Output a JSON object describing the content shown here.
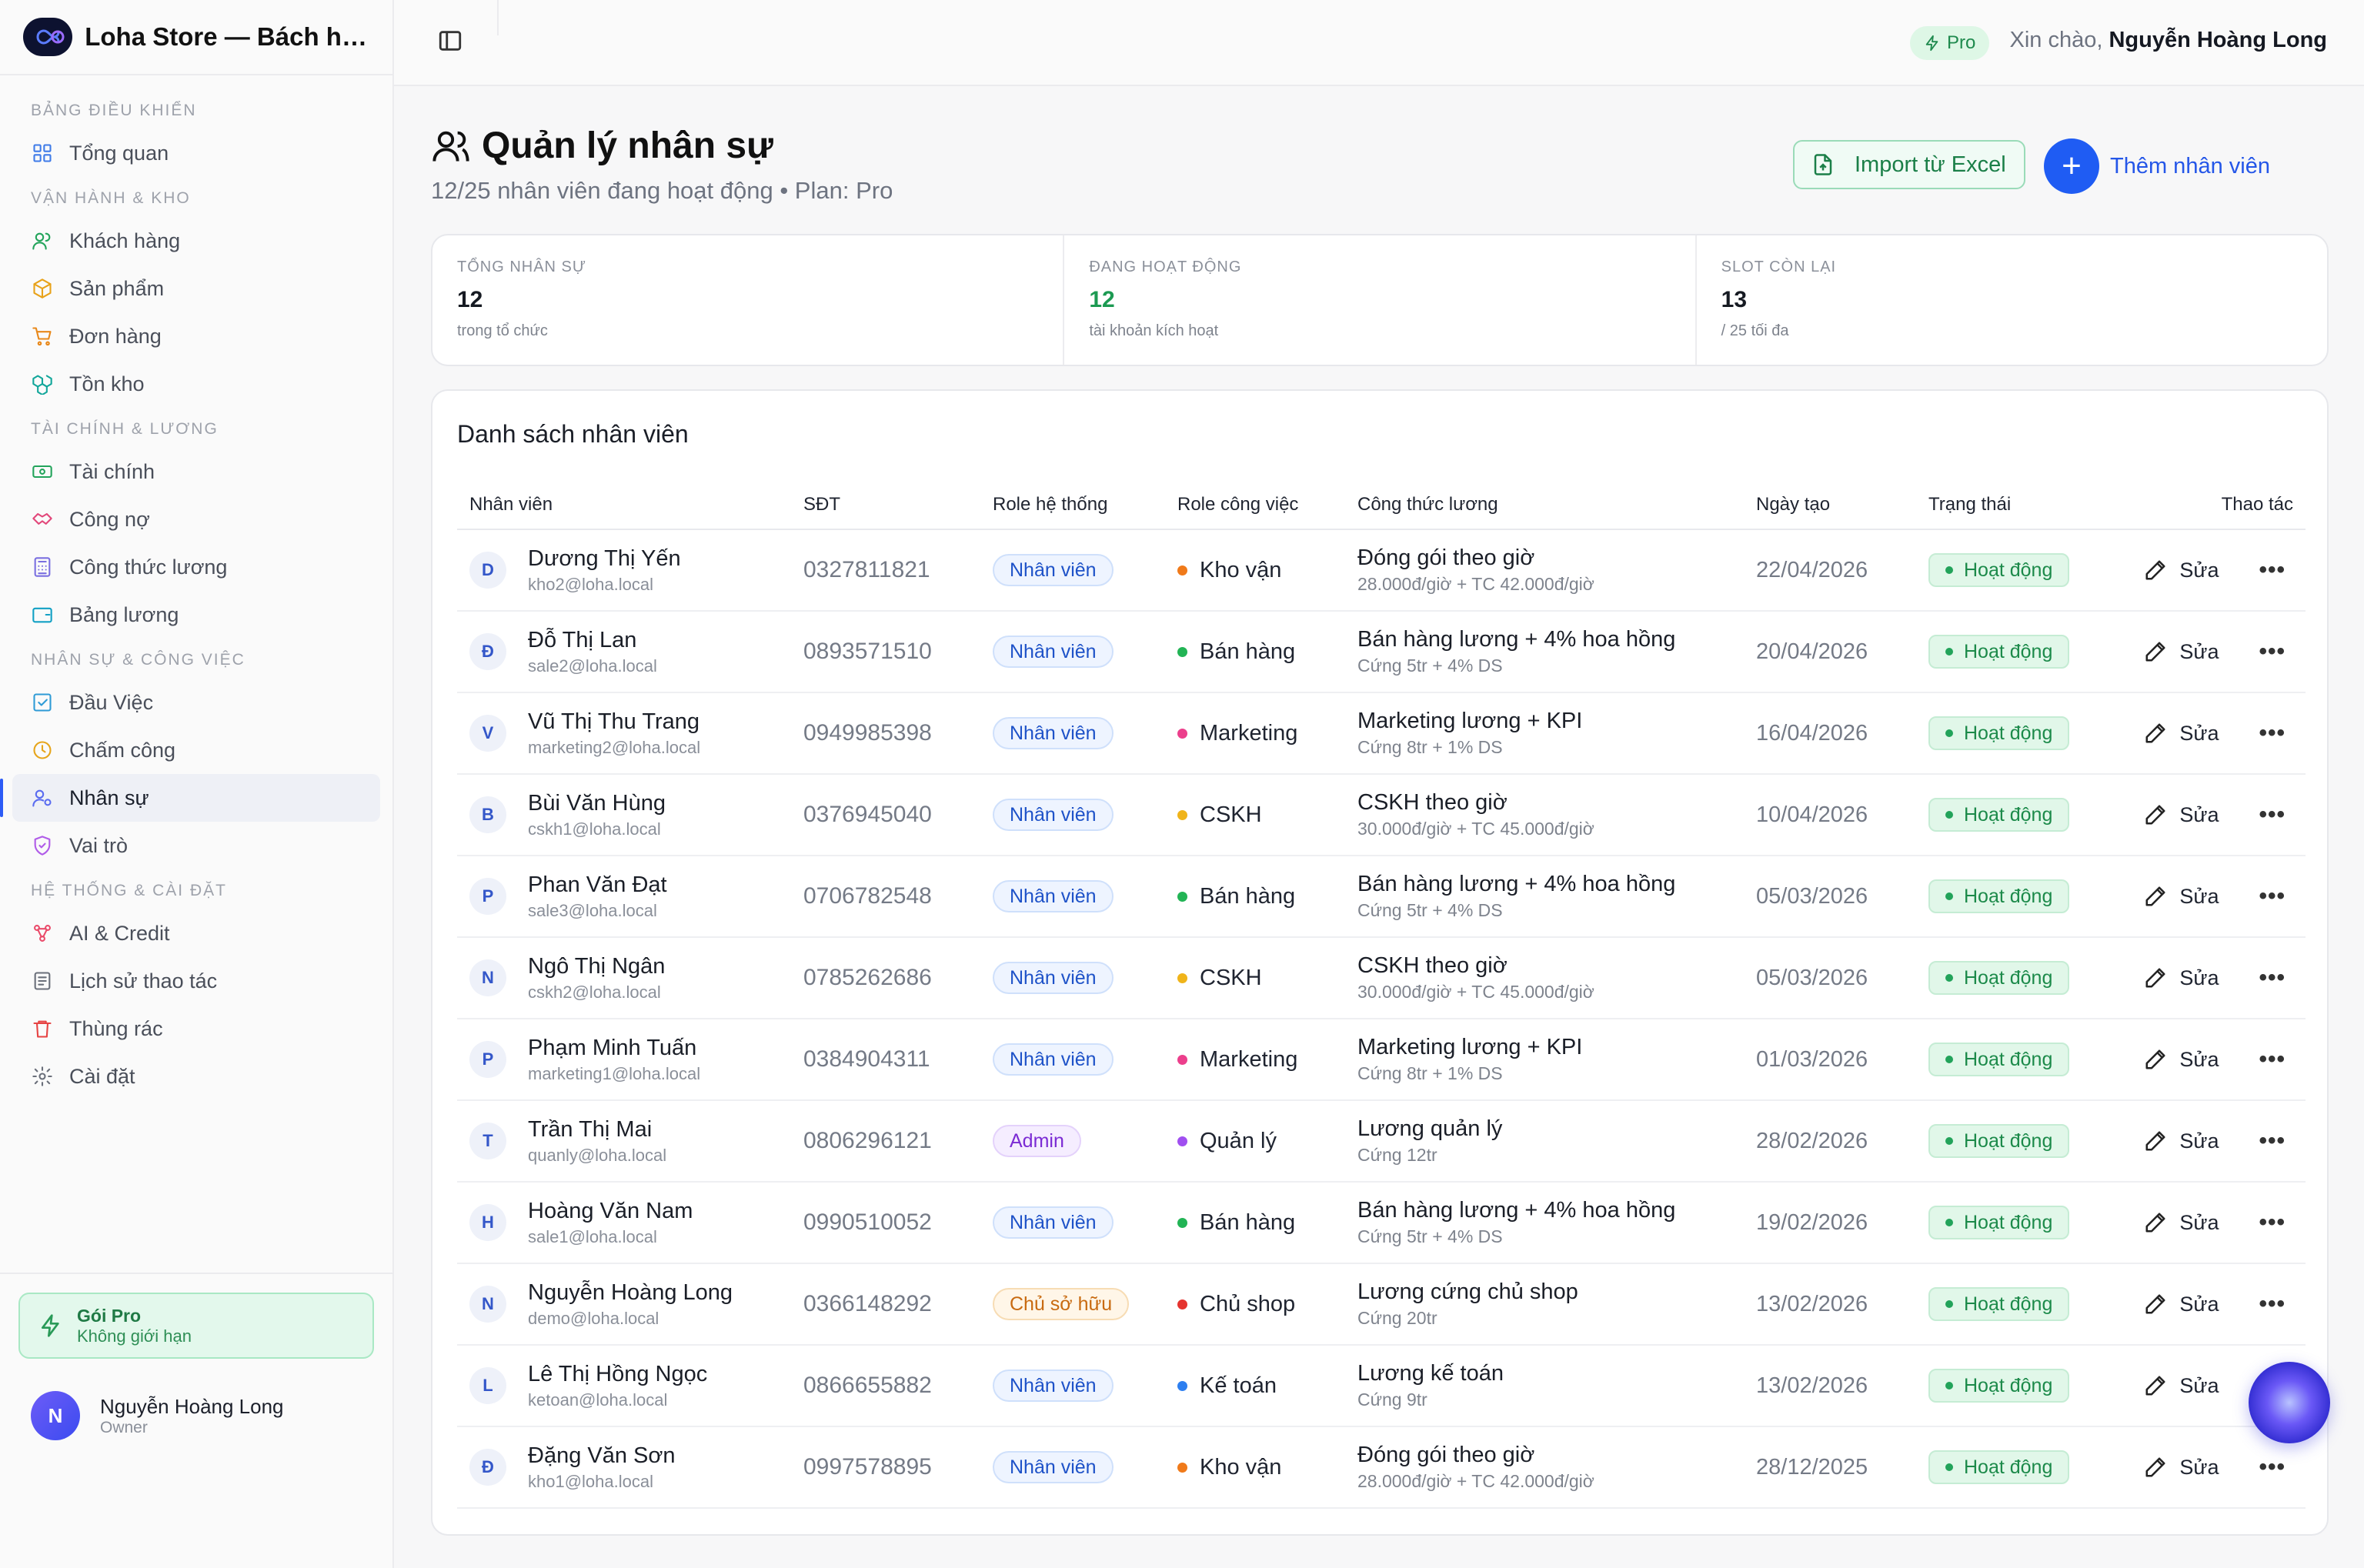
{
  "brand": {
    "title": "Loha Store — Bách hóa ..."
  },
  "sidebar": {
    "sections": [
      {
        "title": "BẢNG ĐIỀU KHIỂN",
        "items": [
          {
            "label": "Tổng quan",
            "icon": "grid-icon"
          }
        ]
      },
      {
        "title": "VẬN HÀNH & KHO",
        "items": [
          {
            "label": "Khách hàng",
            "icon": "users-icon"
          },
          {
            "label": "Sản phẩm",
            "icon": "box-icon"
          },
          {
            "label": "Đơn hàng",
            "icon": "cart-icon"
          },
          {
            "label": "Tồn kho",
            "icon": "boxes-icon"
          }
        ]
      },
      {
        "title": "TÀI CHÍNH & LƯƠNG",
        "items": [
          {
            "label": "Tài chính",
            "icon": "banknote-icon"
          },
          {
            "label": "Công nợ",
            "icon": "handshake-icon"
          },
          {
            "label": "Công thức lương",
            "icon": "calculator-icon"
          },
          {
            "label": "Bảng lương",
            "icon": "wallet-icon"
          }
        ]
      },
      {
        "title": "NHÂN SỰ & CÔNG VIỆC",
        "items": [
          {
            "label": "Đầu Việc",
            "icon": "checkbox-icon"
          },
          {
            "label": "Chấm công",
            "icon": "clock-icon"
          },
          {
            "label": "Nhân sự",
            "icon": "user-cog-icon",
            "active": true
          },
          {
            "label": "Vai trò",
            "icon": "shield-icon"
          }
        ]
      },
      {
        "title": "HỆ THỐNG & CÀI ĐẶT",
        "items": [
          {
            "label": "AI & Credit",
            "icon": "nodes-icon"
          },
          {
            "label": "Lịch sử thao tác",
            "icon": "history-icon"
          },
          {
            "label": "Thùng rác",
            "icon": "trash-icon"
          },
          {
            "label": "Cài đặt",
            "icon": "gear-icon"
          }
        ]
      }
    ],
    "plan": {
      "title": "Gói Pro",
      "subtitle": "Không giới hạn"
    },
    "user": {
      "initial": "N",
      "name": "Nguyễn Hoàng Long",
      "role": "Owner"
    }
  },
  "topbar": {
    "plan_chip": "Pro",
    "greeting": "Xin chào,",
    "user_name": "Nguyễn Hoàng Long"
  },
  "page": {
    "title": "Quản lý nhân sự",
    "subtitle": "12/25 nhân viên đang hoạt động • Plan: Pro",
    "import_label": "Import từ Excel",
    "add_label": "Thêm nhân viên"
  },
  "stats": [
    {
      "label": "TỔNG NHÂN SỰ",
      "value": "12",
      "sub": "trong tổ chức",
      "color": "#161a22"
    },
    {
      "label": "ĐANG HOẠT ĐỘNG",
      "value": "12",
      "sub": "tài khoản kích hoạt",
      "color": "#1c9a52"
    },
    {
      "label": "SLOT CÒN LẠI",
      "value": "13",
      "sub": "/ 25 tối đa",
      "color": "#161a22"
    }
  ],
  "table": {
    "title": "Danh sách nhân viên",
    "headers": [
      "Nhân viên",
      "SĐT",
      "Role hệ thống",
      "Role công việc",
      "Công thức lương",
      "Ngày tạo",
      "Trạng thái",
      "Thao tác"
    ],
    "edit_label": "Sửa",
    "rows": [
      {
        "initial": "D",
        "name": "Dương Thị Yến",
        "email": "kho2@loha.local",
        "phone": "0327811821",
        "sys_role": "Nhân viên",
        "sys_role_kind": "staff",
        "job": "Kho vận",
        "job_color": "#f07a1a",
        "formula": "Đóng gói theo giờ",
        "formula_detail": "28.000đ/giờ + TC 42.000đ/giờ",
        "date": "22/04/2026",
        "status": "Hoạt động"
      },
      {
        "initial": "Đ",
        "name": "Đỗ Thị Lan",
        "email": "sale2@loha.local",
        "phone": "0893571510",
        "sys_role": "Nhân viên",
        "sys_role_kind": "staff",
        "job": "Bán hàng",
        "job_color": "#22b455",
        "formula": "Bán hàng lương + 4% hoa hồng",
        "formula_detail": "Cứng 5tr + 4% DS",
        "date": "20/04/2026",
        "status": "Hoạt động"
      },
      {
        "initial": "V",
        "name": "Vũ Thị Thu Trang",
        "email": "marketing2@loha.local",
        "phone": "0949985398",
        "sys_role": "Nhân viên",
        "sys_role_kind": "staff",
        "job": "Marketing",
        "job_color": "#ec3f8c",
        "formula": "Marketing lương + KPI",
        "formula_detail": "Cứng 8tr + 1% DS",
        "date": "16/04/2026",
        "status": "Hoạt động"
      },
      {
        "initial": "B",
        "name": "Bùi Văn Hùng",
        "email": "cskh1@loha.local",
        "phone": "0376945040",
        "sys_role": "Nhân viên",
        "sys_role_kind": "staff",
        "job": "CSKH",
        "job_color": "#f0b41a",
        "formula": "CSKH theo giờ",
        "formula_detail": "30.000đ/giờ + TC 45.000đ/giờ",
        "date": "10/04/2026",
        "status": "Hoạt động"
      },
      {
        "initial": "P",
        "name": "Phan Văn Đạt",
        "email": "sale3@loha.local",
        "phone": "0706782548",
        "sys_role": "Nhân viên",
        "sys_role_kind": "staff",
        "job": "Bán hàng",
        "job_color": "#22b455",
        "formula": "Bán hàng lương + 4% hoa hồng",
        "formula_detail": "Cứng 5tr + 4% DS",
        "date": "05/03/2026",
        "status": "Hoạt động"
      },
      {
        "initial": "N",
        "name": "Ngô Thị Ngân",
        "email": "cskh2@loha.local",
        "phone": "0785262686",
        "sys_role": "Nhân viên",
        "sys_role_kind": "staff",
        "job": "CSKH",
        "job_color": "#f0b41a",
        "formula": "CSKH theo giờ",
        "formula_detail": "30.000đ/giờ + TC 45.000đ/giờ",
        "date": "05/03/2026",
        "status": "Hoạt động"
      },
      {
        "initial": "P",
        "name": "Phạm Minh Tuấn",
        "email": "marketing1@loha.local",
        "phone": "0384904311",
        "sys_role": "Nhân viên",
        "sys_role_kind": "staff",
        "job": "Marketing",
        "job_color": "#ec3f8c",
        "formula": "Marketing lương + KPI",
        "formula_detail": "Cứng 8tr + 1% DS",
        "date": "01/03/2026",
        "status": "Hoạt động"
      },
      {
        "initial": "T",
        "name": "Trần Thị Mai",
        "email": "quanly@loha.local",
        "phone": "0806296121",
        "sys_role": "Admin",
        "sys_role_kind": "admin",
        "job": "Quản lý",
        "job_color": "#a04ff0",
        "formula": "Lương quản lý",
        "formula_detail": "Cứng 12tr",
        "date": "28/02/2026",
        "status": "Hoạt động"
      },
      {
        "initial": "H",
        "name": "Hoàng Văn Nam",
        "email": "sale1@loha.local",
        "phone": "0990510052",
        "sys_role": "Nhân viên",
        "sys_role_kind": "staff",
        "job": "Bán hàng",
        "job_color": "#22b455",
        "formula": "Bán hàng lương + 4% hoa hồng",
        "formula_detail": "Cứng 5tr + 4% DS",
        "date": "19/02/2026",
        "status": "Hoạt động"
      },
      {
        "initial": "N",
        "name": "Nguyễn Hoàng Long",
        "email": "demo@loha.local",
        "phone": "0366148292",
        "sys_role": "Chủ sở hữu",
        "sys_role_kind": "owner",
        "job": "Chủ shop",
        "job_color": "#e5342f",
        "formula": "Lương cứng chủ shop",
        "formula_detail": "Cứng 20tr",
        "date": "13/02/2026",
        "status": "Hoạt động"
      },
      {
        "initial": "L",
        "name": "Lê Thị Hồng Ngọc",
        "email": "ketoan@loha.local",
        "phone": "0866655882",
        "sys_role": "Nhân viên",
        "sys_role_kind": "staff",
        "job": "Kế toán",
        "job_color": "#2d7ff0",
        "formula": "Lương kế toán",
        "formula_detail": "Cứng 9tr",
        "date": "13/02/2026",
        "status": "Hoạt động"
      },
      {
        "initial": "Đ",
        "name": "Đặng Văn Sơn",
        "email": "kho1@loha.local",
        "phone": "0997578895",
        "sys_role": "Nhân viên",
        "sys_role_kind": "staff",
        "job": "Kho vận",
        "job_color": "#f07a1a",
        "formula": "Đóng gói theo giờ",
        "formula_detail": "28.000đ/giờ + TC 42.000đ/giờ",
        "date": "28/12/2025",
        "status": "Hoạt động"
      }
    ]
  }
}
